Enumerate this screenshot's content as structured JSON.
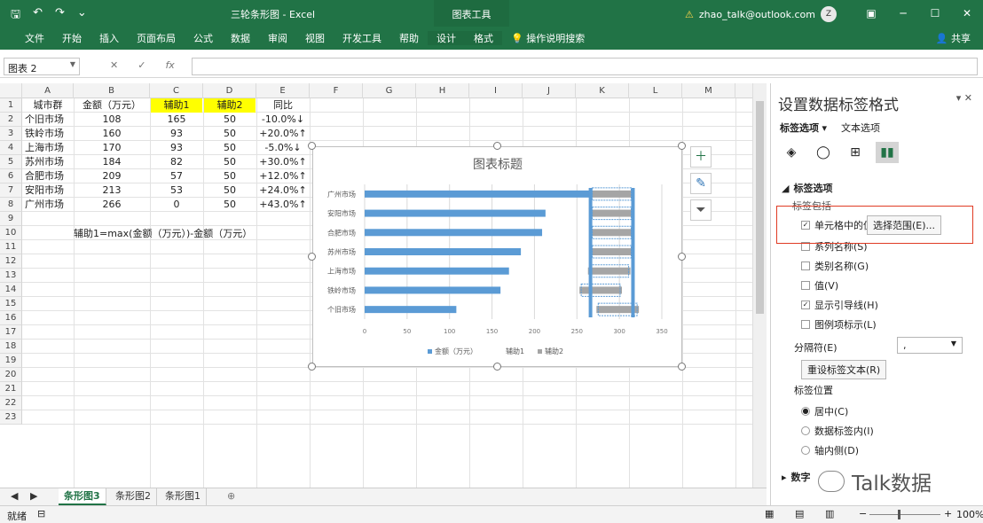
{
  "titlebar": {
    "title": "三轮条形图 - Excel",
    "context_tab": "图表工具",
    "account": "zhao_talk@outlook.com",
    "avatar": "Z",
    "warning_icon": "warning-icon"
  },
  "ribbon": {
    "tabs": [
      "文件",
      "开始",
      "插入",
      "页面布局",
      "公式",
      "数据",
      "审阅",
      "视图",
      "开发工具",
      "帮助",
      "设计",
      "格式"
    ],
    "tellme": "操作说明搜索",
    "share": "共享"
  },
  "formulabar": {
    "namebox": "图表 2",
    "cancel": "✕",
    "enter": "✓",
    "fx": "fx",
    "value": ""
  },
  "columns": [
    "A",
    "B",
    "C",
    "D",
    "E",
    "F",
    "G",
    "H",
    "I",
    "J",
    "K",
    "L",
    "M"
  ],
  "rows": [
    "1",
    "2",
    "3",
    "4",
    "5",
    "6",
    "7",
    "8",
    "9",
    "10",
    "11",
    "12",
    "13",
    "14",
    "15",
    "16",
    "17",
    "18",
    "19",
    "20",
    "21",
    "22",
    "23"
  ],
  "table": {
    "headers": [
      "城市群",
      "金额（万元）",
      "辅助1",
      "辅助2",
      "同比"
    ],
    "data": [
      [
        "个旧市场",
        "108",
        "165",
        "50",
        "-10.0%↓"
      ],
      [
        "铁岭市场",
        "160",
        "93",
        "50",
        "+20.0%↑"
      ],
      [
        "上海市场",
        "170",
        "93",
        "50",
        "-5.0%↓"
      ],
      [
        "苏州市场",
        "184",
        "82",
        "50",
        "+30.0%↑"
      ],
      [
        "合肥市场",
        "209",
        "57",
        "50",
        "+12.0%↑"
      ],
      [
        "安阳市场",
        "213",
        "53",
        "50",
        "+24.0%↑"
      ],
      [
        "广州市场",
        "266",
        "0",
        "50",
        "+43.0%↑"
      ]
    ],
    "formula_note": "辅助1=max(金额（万元）)-金额（万元）"
  },
  "chart_data": {
    "type": "bar",
    "title": "图表标题",
    "categories": [
      "个旧市场",
      "铁岭市场",
      "上海市场",
      "苏州市场",
      "合肥市场",
      "安阳市场",
      "广州市场"
    ],
    "series": [
      {
        "name": "金额（万元）",
        "values": [
          108,
          160,
          170,
          184,
          209,
          213,
          266
        ]
      },
      {
        "name": "辅助1",
        "values": [
          165,
          93,
          93,
          82,
          57,
          53,
          0
        ]
      },
      {
        "name": "辅助2",
        "values": [
          50,
          50,
          50,
          50,
          50,
          50,
          50
        ]
      }
    ],
    "x_ticks": [
      "0",
      "50",
      "100",
      "150",
      "200",
      "250",
      "300",
      "350"
    ],
    "xlim": [
      0,
      350
    ],
    "legend": "bottom",
    "grid": true,
    "colors": {
      "series1": "#5b9bd5",
      "series3": "#a5a5a5"
    }
  },
  "chart_tools": [
    "plus-icon",
    "brush-icon",
    "filter-icon"
  ],
  "sheets": [
    "条形图3",
    "条形图2",
    "条形图1"
  ],
  "status": {
    "ready": "就绪",
    "zoom": "100%"
  },
  "pane": {
    "title": "设置数据标签格式",
    "tab1": "标签选项",
    "tab2": "文本选项",
    "section": "标签选项",
    "group": "标签包括",
    "opt_cells": "单元格中的值",
    "select_range": "选择范围(E)...",
    "opt_series": "系列名称(S)",
    "opt_category": "类别名称(G)",
    "opt_value": "值(V)",
    "opt_leader": "显示引导线(H)",
    "opt_legend": "图例项标示(L)",
    "separator_label": "分隔符(E)",
    "separator_value": ",",
    "reset": "重设标签文本(R)",
    "position": "标签位置",
    "pos_center": "居中(C)",
    "pos_inside_base": "数据标签内(I)",
    "pos_inside_end": "轴内侧(D)",
    "more": "数字"
  },
  "watermark": "Talk数据"
}
